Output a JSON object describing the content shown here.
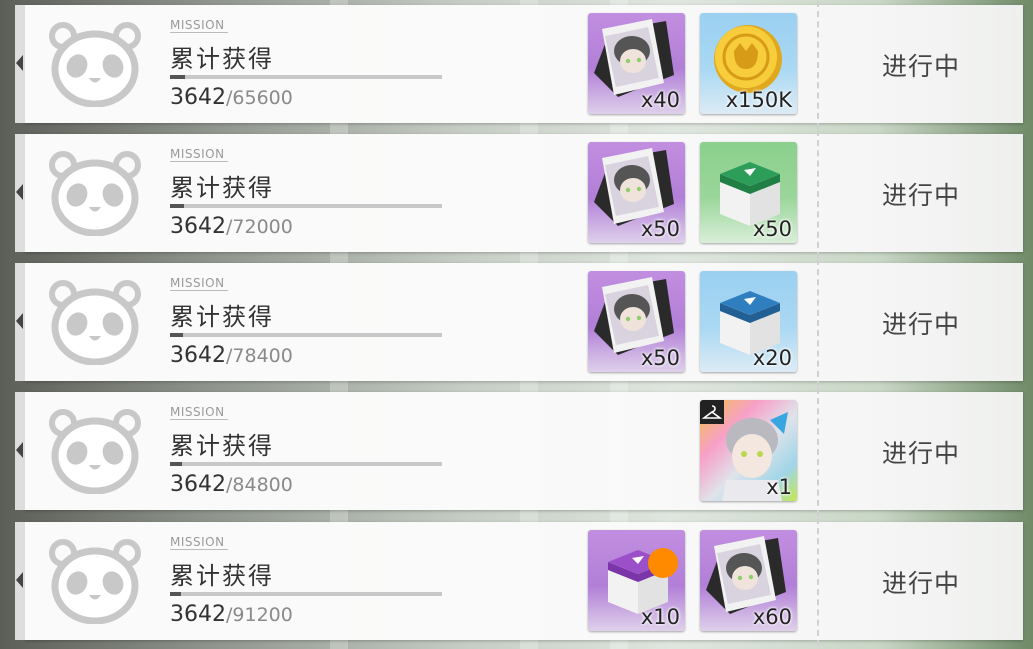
{
  "missions": [
    {
      "tag": "MISSION",
      "title": "累计获得",
      "current": "3642",
      "target": "/65600",
      "progress": 0.0555,
      "status": "进行中",
      "rewards": [
        {
          "icon": "character-photo-icon",
          "bg": "purple",
          "count": "x40"
        },
        {
          "icon": "gold-coin-icon",
          "bg": "blue",
          "count": "x150K"
        }
      ]
    },
    {
      "tag": "MISSION",
      "title": "累计获得",
      "current": "3642",
      "target": "/72000",
      "progress": 0.0506,
      "status": "进行中",
      "rewards": [
        {
          "icon": "character-photo-icon",
          "bg": "purple",
          "count": "x50"
        },
        {
          "icon": "green-supply-box-icon",
          "bg": "green",
          "count": "x50"
        }
      ]
    },
    {
      "tag": "MISSION",
      "title": "累计获得",
      "current": "3642",
      "target": "/78400",
      "progress": 0.0465,
      "status": "进行中",
      "rewards": [
        {
          "icon": "character-photo-icon",
          "bg": "purple",
          "count": "x50"
        },
        {
          "icon": "blue-supply-box-icon",
          "bg": "blue",
          "count": "x20"
        }
      ]
    },
    {
      "tag": "MISSION",
      "title": "累计获得",
      "current": "3642",
      "target": "/84800",
      "progress": 0.0429,
      "status": "进行中",
      "rewards": [
        {
          "icon": "outfit-skin-icon",
          "bg": "skin",
          "count": "x1"
        }
      ]
    },
    {
      "tag": "MISSION",
      "title": "累计获得",
      "current": "3642",
      "target": "/91200",
      "progress": 0.0399,
      "status": "进行中",
      "rewards": [
        {
          "icon": "purple-supply-box-icon",
          "bg": "purple",
          "count": "x10"
        },
        {
          "icon": "character-photo-icon",
          "bg": "purple",
          "count": "x60"
        }
      ]
    }
  ],
  "colors": {
    "reward_purple": "#b27fd8",
    "reward_blue": "#9bd0f1",
    "reward_green": "#8bd08c",
    "badge_orange": "#ff8a00",
    "panda_gray": "#c8c8c8"
  }
}
